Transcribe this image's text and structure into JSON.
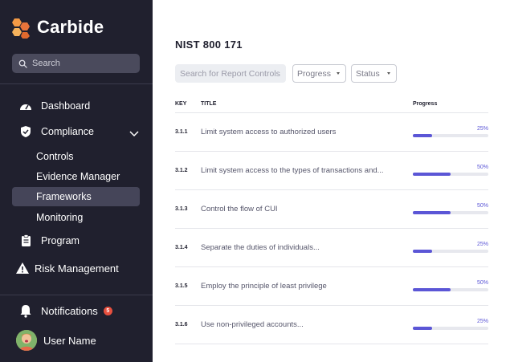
{
  "app": {
    "name": "Carbide"
  },
  "sidebar": {
    "search_placeholder": "Search",
    "nav": {
      "dashboard": "Dashboard",
      "compliance": "Compliance",
      "controls": "Controls",
      "evidence_manager": "Evidence Manager",
      "frameworks": "Frameworks",
      "monitoring": "Monitoring",
      "program": "Program",
      "risk_management": "Risk Management"
    },
    "notifications": {
      "label": "Notifications",
      "count": "5"
    },
    "user": {
      "name": "User Name"
    }
  },
  "main": {
    "title": "NIST 800 171",
    "search_placeholder": "Search for Report Controls",
    "filters": {
      "progress": "Progress",
      "status": "Status"
    },
    "columns": {
      "key": "KEY",
      "title": "TITLE",
      "progress": "Progress"
    },
    "rows": [
      {
        "key": "3.1.1",
        "title": "Limit system access to authorized users",
        "progress_label": "25%",
        "progress": 25
      },
      {
        "key": "3.1.2",
        "title": "Limit system access to the types of transactions and...",
        "progress_label": "50%",
        "progress": 50
      },
      {
        "key": "3.1.3",
        "title": "Control the flow of CUI",
        "progress_label": "50%",
        "progress": 50
      },
      {
        "key": "3.1.4",
        "title": "Separate the duties of individuals...",
        "progress_label": "25%",
        "progress": 25
      },
      {
        "key": "3.1.5",
        "title": "Employ the principle of least privilege",
        "progress_label": "50%",
        "progress": 50
      },
      {
        "key": "3.1.6",
        "title": "Use non-privileged accounts...",
        "progress_label": "25%",
        "progress": 25
      }
    ]
  },
  "colors": {
    "sidebar": "#20202e",
    "accent": "#5b56d6",
    "logo": "#f08a3c",
    "badge": "#e8503f"
  }
}
